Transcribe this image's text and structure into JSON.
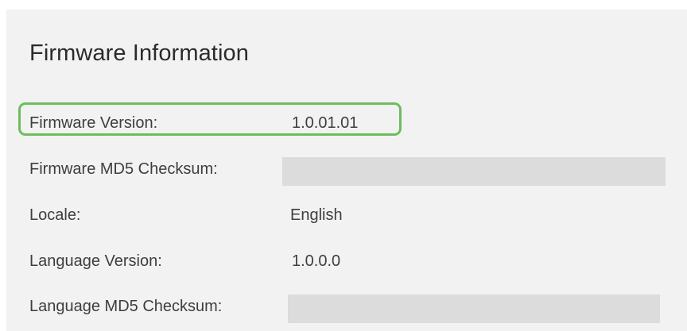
{
  "section": {
    "title": "Firmware Information"
  },
  "rows": [
    {
      "label": "Firmware Version:",
      "value": "1.0.01.01"
    },
    {
      "label": "Firmware MD5 Checksum:",
      "value": ""
    },
    {
      "label": "Locale:",
      "value": "English"
    },
    {
      "label": "Language Version:",
      "value": "1.0.0.0"
    },
    {
      "label": "Language MD5 Checksum:",
      "value": ""
    }
  ],
  "colors": {
    "highlight_border": "#6ebd5b",
    "panel_background": "#f2f2f2",
    "redacted_fill": "#dcdcdc"
  }
}
